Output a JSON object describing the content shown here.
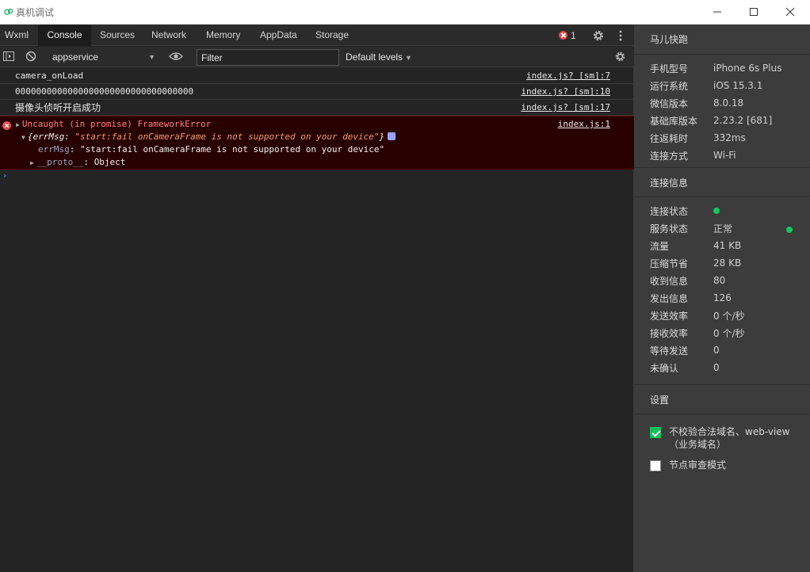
{
  "window": {
    "title": "真机调试",
    "controls": {
      "minimize": "–",
      "maximize": "☐",
      "close": "✕"
    }
  },
  "tabs": [
    "Wxml",
    "Console",
    "Sources",
    "Network",
    "Memory",
    "AppData",
    "Storage"
  ],
  "active_tab": "Console",
  "error_count": "1",
  "toolbar": {
    "context": "appservice",
    "filter_placeholder": "Filter",
    "levels": "Default levels"
  },
  "console": {
    "logs": [
      {
        "text": "camera_onLoad",
        "source": "index.js? [sm]:7"
      },
      {
        "text": "0000000000000000000000000000000000",
        "source": "index.js? [sm]:10"
      },
      {
        "text": "摄像头侦听开启成功",
        "source": "index.js? [sm]:17"
      }
    ],
    "error": {
      "message": "Uncaught (in promise) FrameworkError",
      "source": "index.js:1",
      "object_open": "{errMsg: ",
      "object_value": "\"start:fail onCameraFrame is not supported on your device\"",
      "object_close": "}",
      "prop_key": "errMsg",
      "prop_value": "\"start:fail onCameraFrame is not supported on your device\"",
      "proto_key": "__proto__",
      "proto_value": "Object"
    },
    "prompt": "›"
  },
  "panel": {
    "app_name": "马儿快跑",
    "device_info": [
      {
        "key": "手机型号",
        "value": "iPhone 6s Plus"
      },
      {
        "key": "运行系统",
        "value": "iOS 15.3.1"
      },
      {
        "key": "微信版本",
        "value": "8.0.18"
      },
      {
        "key": "基础库版本",
        "value": "2.23.2 [681]"
      },
      {
        "key": "往返耗时",
        "value": "332ms"
      },
      {
        "key": "连接方式",
        "value": "Wi-Fi"
      }
    ],
    "connection_title": "连接信息",
    "connection_info": [
      {
        "key": "连接状态",
        "value": ""
      },
      {
        "key": "服务状态",
        "value": "正常"
      },
      {
        "key": "流量",
        "value": "41 KB"
      },
      {
        "key": "压缩节省",
        "value": "28 KB"
      },
      {
        "key": "收到信息",
        "value": "80"
      },
      {
        "key": "发出信息",
        "value": "126"
      },
      {
        "key": "发送效率",
        "value": "0 个/秒"
      },
      {
        "key": "接收效率",
        "value": "0 个/秒"
      },
      {
        "key": "等待发送",
        "value": "0"
      },
      {
        "key": "未确认",
        "value": "0"
      }
    ],
    "settings_title": "设置",
    "settings": [
      {
        "label": "不校验合法域名、web-view（业务域名）",
        "checked": true
      },
      {
        "label": "节点审查模式",
        "checked": false
      }
    ],
    "status_color": "#18c45c"
  }
}
